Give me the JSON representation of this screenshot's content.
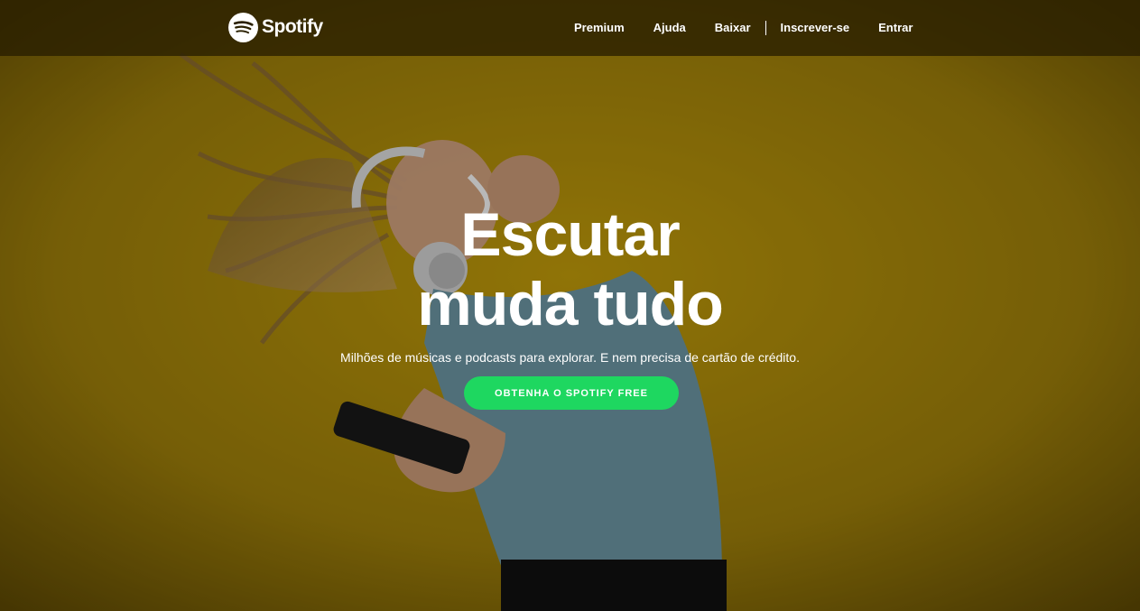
{
  "brand": {
    "name": "Spotify",
    "logo_icon": "spotify-logo-icon"
  },
  "nav": {
    "items": [
      {
        "label": "Premium"
      },
      {
        "label": "Ajuda"
      },
      {
        "label": "Baixar"
      },
      {
        "label": "Inscrever-se"
      },
      {
        "label": "Entrar"
      }
    ]
  },
  "hero": {
    "headline_line1": "Escutar",
    "headline_line2": "muda tudo",
    "subtitle": "Milhões de músicas e podcasts para explorar. E nem precisa de cartão de crédito.",
    "cta_label": "OBTENHA O SPOTIFY FREE",
    "background_image": "woman-with-headphones-dancing-on-yellow-background"
  },
  "colors": {
    "accent": "#1ed760",
    "background": "#c79b06",
    "nav_background": "#2b2100"
  }
}
